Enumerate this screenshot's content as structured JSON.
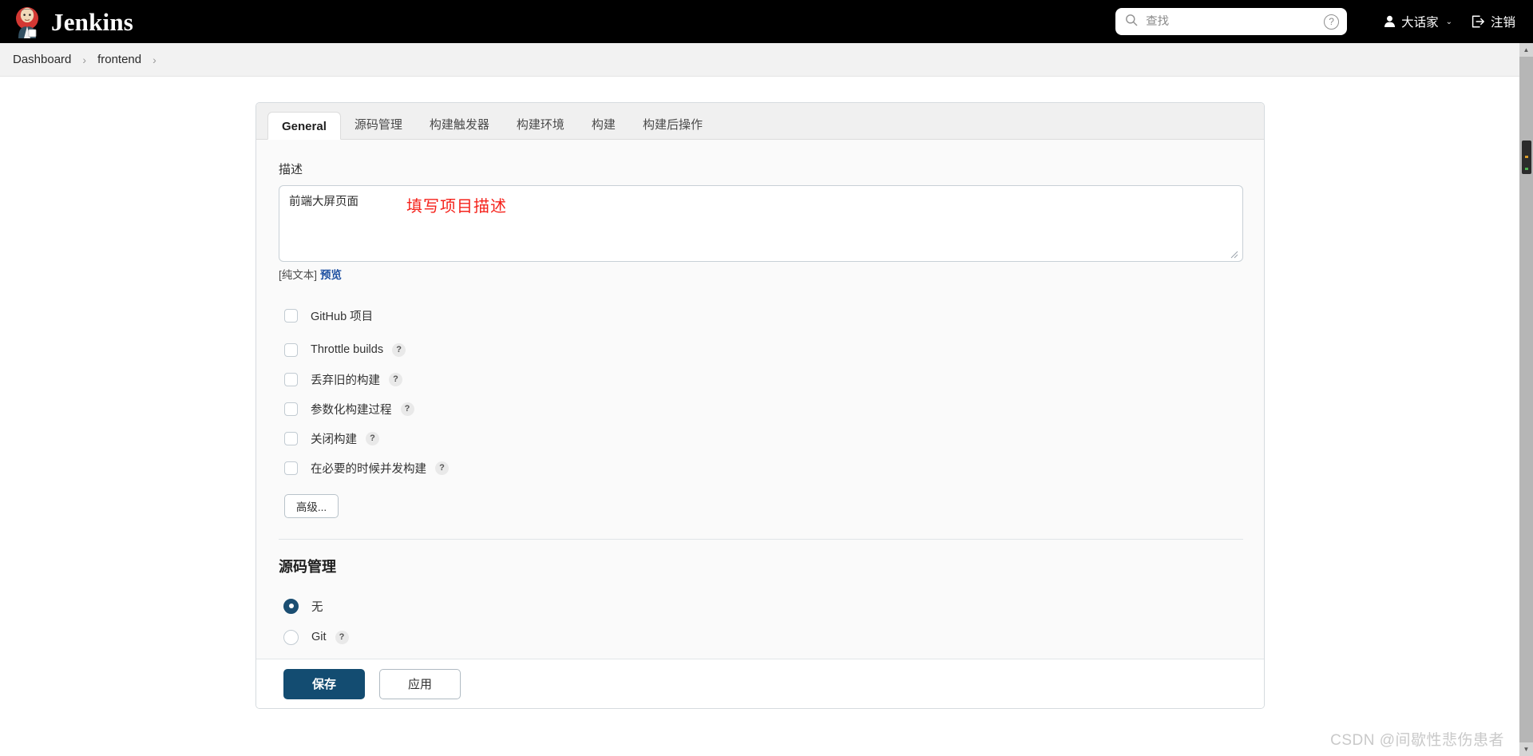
{
  "header": {
    "brand": "Jenkins",
    "logo_icon": "jenkins-butler-logo",
    "search": {
      "placeholder": "查找",
      "value": "",
      "icon": "search-icon",
      "help_badge": "?"
    },
    "user": {
      "name": "大话家",
      "icon": "person-icon",
      "caret": "⌄"
    },
    "logout": {
      "label": "注销",
      "icon": "logout-icon"
    }
  },
  "breadcrumb": {
    "items": [
      "Dashboard",
      "frontend"
    ],
    "separator": "›",
    "trailing_separator": "›"
  },
  "tabs": [
    {
      "label": "General",
      "active": true
    },
    {
      "label": "源码管理",
      "active": false
    },
    {
      "label": "构建触发器",
      "active": false
    },
    {
      "label": "构建环境",
      "active": false
    },
    {
      "label": "构建",
      "active": false
    },
    {
      "label": "构建后操作",
      "active": false
    }
  ],
  "general": {
    "description_label": "描述",
    "description_value": "前端大屏页面",
    "description_placeholder": "",
    "annotation": "填写项目描述",
    "annotation_color": "#f5221b",
    "plain_text_label": "[纯文本]",
    "preview_link": "预览",
    "checkboxes": [
      {
        "label": "GitHub 项目",
        "checked": false,
        "help": false
      },
      {
        "label": "Throttle builds",
        "checked": false,
        "help": true,
        "help_glyph": "?"
      },
      {
        "label": "丢弃旧的构建",
        "checked": false,
        "help": true,
        "help_glyph": "?"
      },
      {
        "label": "参数化构建过程",
        "checked": false,
        "help": true,
        "help_glyph": "?"
      },
      {
        "label": "关闭构建",
        "checked": false,
        "help": true,
        "help_glyph": "?"
      },
      {
        "label": "在必要的时候并发构建",
        "checked": false,
        "help": true,
        "help_glyph": "?"
      }
    ],
    "advanced_button": "高级..."
  },
  "scm": {
    "title": "源码管理",
    "options": [
      {
        "label": "无",
        "selected": true,
        "help": false
      },
      {
        "label": "Git",
        "selected": false,
        "help": true,
        "help_glyph": "?"
      }
    ]
  },
  "actions": {
    "save": "保存",
    "apply": "应用"
  },
  "watermark": "CSDN @间歇性悲伤患者",
  "colors": {
    "header_bg": "#000000",
    "accent": "#134c71",
    "link": "#1c4fa1",
    "annotation": "#f5221b",
    "card_bg": "#fafafa"
  }
}
